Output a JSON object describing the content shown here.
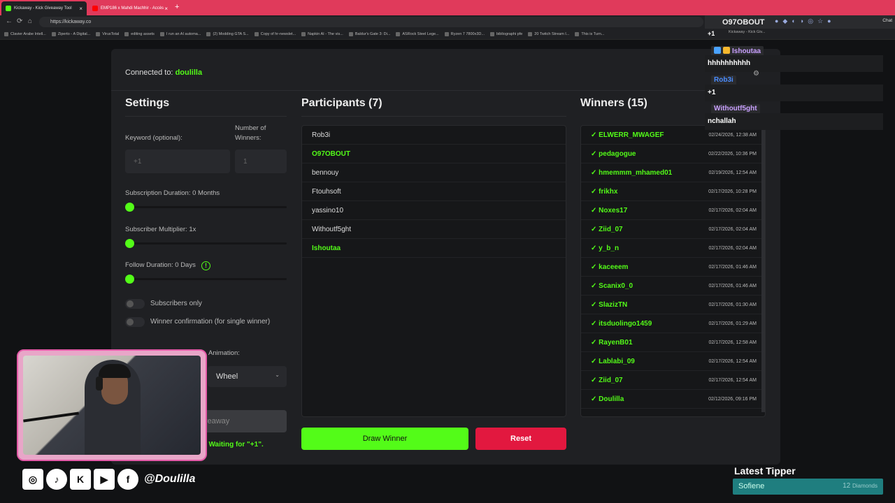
{
  "browser": {
    "tabs": [
      {
        "label": "Kickaway - Kick Giveaway Tool",
        "active": true
      },
      {
        "label": "EMP186 x Mahdi Machhir - Accès",
        "active": false
      }
    ],
    "url": "https://kickaway.co",
    "bookmarks": [
      "Clavier Arabe Intell...",
      "Ziperto - A Digital...",
      "VirusTotal",
      "editing assets",
      "I run an AI automa...",
      "(2) Modding GTA S...",
      "Copy of hr-newslet...",
      "Napkin AI - The vis...",
      "Baldur's Gate 3: Di...",
      "ASRock Steel Lege...",
      "Ryzen 7 7800x3D...",
      "bibliographi pfe",
      "20 Twitch Stream I...",
      "This is Turn..."
    ]
  },
  "app": {
    "connected_label": "Connected to:",
    "connected_user": "doulilla",
    "settings": {
      "title": "Settings",
      "keyword_label": "Keyword (optional):",
      "keyword_placeholder": "+1",
      "winners_label_1": "Number of",
      "winners_label_2": "Winners:",
      "winners_placeholder": "1",
      "sub_duration_label": "Subscription Duration: 0 Months",
      "sub_multiplier_label": "Subscriber Multiplier: 1x",
      "follow_duration_label": "Follow Duration: 0 Days",
      "subscribers_only_label": "Subscribers only",
      "winner_confirm_label": "Winner confirmation (for single winner)",
      "animation_label": "Animation:",
      "animation_value": "Wheel",
      "start_button_label": "veaway",
      "status_text": "t! Waiting for \"+1\".",
      "sub_duration_value": 0,
      "sub_multiplier_value": 1,
      "follow_duration_value": 0
    },
    "participants": {
      "title": "Participants (7)",
      "items": [
        {
          "name": "Rob3i",
          "highlight": false
        },
        {
          "name": "O97OBOUT",
          "highlight": true
        },
        {
          "name": "bennouy",
          "highlight": false
        },
        {
          "name": "Ftouhsoft",
          "highlight": false
        },
        {
          "name": "yassino10",
          "highlight": false
        },
        {
          "name": "Withoutf5ght",
          "highlight": false
        },
        {
          "name": "Ishoutaa",
          "highlight": true
        }
      ]
    },
    "winners": {
      "title": "Winners (15)",
      "items": [
        {
          "name": "✓ ELWERR_MWAGEF",
          "date": "02/24/2026, 12:38 AM"
        },
        {
          "name": "✓ pedagogue",
          "date": "02/22/2026, 10:36 PM"
        },
        {
          "name": "✓ hmemmm_mhamed01",
          "date": "02/19/2026, 12:54 AM"
        },
        {
          "name": "✓ frikhx",
          "date": "02/17/2026, 10:28 PM"
        },
        {
          "name": "✓ Noxes17",
          "date": "02/17/2026, 02:04 AM"
        },
        {
          "name": "✓ Ziid_07",
          "date": "02/17/2026, 02:04 AM"
        },
        {
          "name": "✓ y_b_n",
          "date": "02/17/2026, 02:04 AM"
        },
        {
          "name": "✓ kaceeem",
          "date": "02/17/2026, 01:46 AM"
        },
        {
          "name": "✓ Scanix0_0",
          "date": "02/17/2026, 01:46 AM"
        },
        {
          "name": "✓ SlazizTN",
          "date": "02/17/2026, 01:30 AM"
        },
        {
          "name": "✓ itsduolingo1459",
          "date": "02/17/2026, 01:29 AM"
        },
        {
          "name": "✓ RayenB01",
          "date": "02/17/2026, 12:58 AM"
        },
        {
          "name": "✓ Lablabi_09",
          "date": "02/17/2026, 12:54 AM"
        },
        {
          "name": "✓ Ziid_07",
          "date": "02/17/2026, 12:54 AM"
        },
        {
          "name": "✓ Doulilla",
          "date": "02/12/2026, 09:16 PM"
        }
      ]
    },
    "draw_button": "Draw Winner",
    "reset_button": "Reset"
  },
  "chat": {
    "header_name": "O97OBOUT",
    "chat_button": "Chat",
    "tab_label": "Kickaway - Kick Giv...",
    "top_message": "+1",
    "messages": [
      {
        "user": "Ishoutaa",
        "text": "hhhhhhhhhh",
        "color": "#c9a0ff"
      },
      {
        "user": "Rob3i",
        "text": "+1",
        "color": "#4a8cff"
      },
      {
        "user": "Withoutf5ght",
        "text": "nchallah",
        "color": "#c9a0ff"
      }
    ]
  },
  "overlay": {
    "handle": "@Doulilla",
    "social_icons": [
      "instagram-icon",
      "tiktok-icon",
      "kick-icon",
      "youtube-icon",
      "facebook-icon"
    ],
    "latest_tipper_title": "Latest Tipper",
    "tipper_name": "Sofiene",
    "tipper_amount": "12",
    "tipper_unit": "Diamonds"
  },
  "colors": {
    "accent": "#53fc18",
    "danger": "#e2183f",
    "tab_bar": "#e03a5b",
    "cam_border": "#e45aa8"
  }
}
